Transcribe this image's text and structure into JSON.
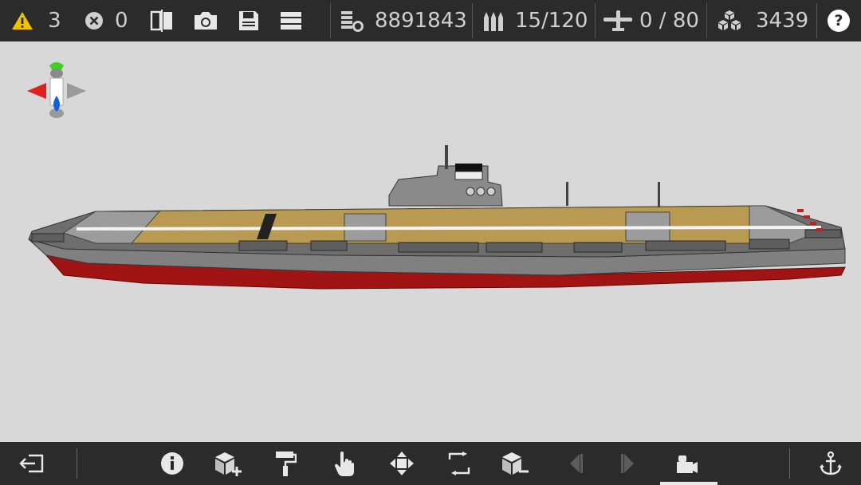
{
  "topbar": {
    "warnings_count": "3",
    "errors_count": "0",
    "icons": {
      "warning": "warning-icon",
      "error": "error-icon",
      "compare": "compare-view-icon",
      "camera": "screenshot-camera-icon",
      "save": "save-icon",
      "menu": "menu-icon",
      "cost": "cost-icon",
      "ammo": "ammo-icon",
      "aircraft": "aircraft-icon",
      "blocks": "blocks-icon",
      "help": "help-icon"
    },
    "cost_value": "8891843",
    "ammo_value": "15/120",
    "aircraft_value": "0 / 80",
    "blocks_value": "3439",
    "help_label": "?"
  },
  "bottombar": {
    "tools": [
      {
        "name": "exit"
      },
      {
        "name": "info"
      },
      {
        "name": "add-block"
      },
      {
        "name": "paint"
      },
      {
        "name": "select"
      },
      {
        "name": "move"
      },
      {
        "name": "rotate"
      },
      {
        "name": "remove-block"
      },
      {
        "name": "undo"
      },
      {
        "name": "redo"
      },
      {
        "name": "camera-view"
      },
      {
        "name": "anchor"
      }
    ],
    "active_tool": "camera-view"
  },
  "colors": {
    "bar_bg": "#2b2b2b",
    "viewport_bg": "#d8d8d8",
    "warning": "#f2c200",
    "deck": "#b99a52",
    "hull": "#7a7a7a",
    "waterline": "#a01414",
    "axis_x": "#e02020",
    "axis_y": "#40d020",
    "axis_z": "#1060e0"
  }
}
